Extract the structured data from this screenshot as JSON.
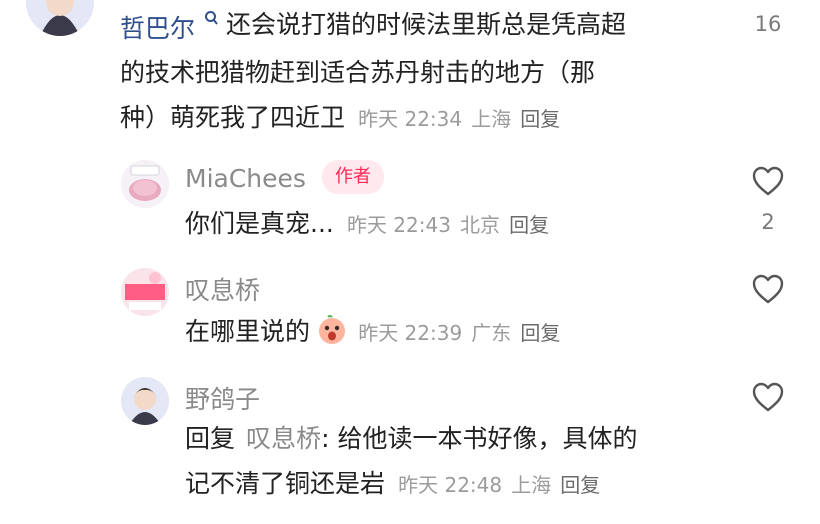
{
  "comments": [
    {
      "username": "哲巴尔",
      "text_line1": "还会说打猎的时候法里斯总是凭高超",
      "text_line2": "的技术把猎物赶到适合苏丹射击的地方（那",
      "text_line3": "种）萌死我了四近卫",
      "time": "昨天 22:34",
      "location": "上海",
      "reply_label": "回复",
      "like_count": "16"
    }
  ],
  "replies": [
    {
      "username": "MiaChees",
      "badge": "作者",
      "text": "你们是真宠...",
      "time": "昨天 22:43",
      "location": "北京",
      "reply_label": "回复",
      "like_count": "2"
    },
    {
      "username": "叹息桥",
      "text": "在哪里说的",
      "emoji": "😮",
      "time": "昨天 22:39",
      "location": "广东",
      "reply_label": "回复",
      "like_count": ""
    },
    {
      "username": "野鸽子",
      "reply_prefix": "回复",
      "reply_target": "叹息桥",
      "text_line1": ": 给他读一本书好像，具体的",
      "text_line2": "记不清了铜还是岩",
      "time": "昨天 22:48",
      "location": "上海",
      "reply_label": "回复",
      "like_count": ""
    }
  ],
  "icons": {
    "like": "heart-outline-icon",
    "verified": "search-icon"
  },
  "colors": {
    "username_top": "#2f4f8f",
    "username_gray": "#8a8a8a",
    "author_badge_text": "#ff2b55",
    "author_badge_bg": "#ffe9ee"
  }
}
